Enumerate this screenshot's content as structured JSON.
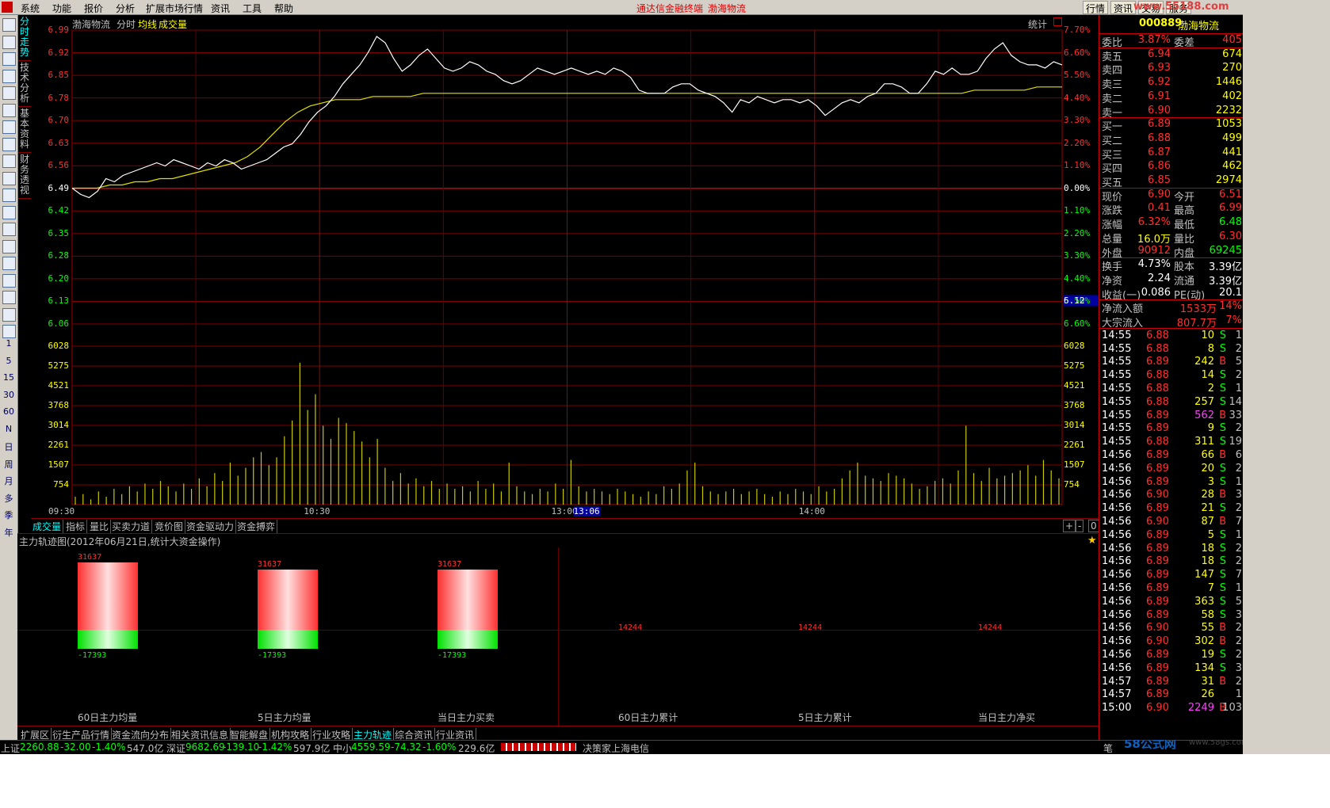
{
  "app": {
    "menu": [
      "系统",
      "功能",
      "报价",
      "分析",
      "扩展市场行情",
      "资讯",
      "工具",
      "帮助"
    ],
    "center_title": "通达信金融终端",
    "center_stock": "渤海物流",
    "right_buttons": [
      "行情",
      "资讯",
      "交易",
      "服务"
    ],
    "watermark": "www.55188.com",
    "footer_watermark": "58公式网",
    "footer_url": "www.58gs.com"
  },
  "left_toolbar": {
    "icon_names": [
      "home-icon",
      "grid-icon",
      "list-icon",
      "line-chart-icon",
      "candle-icon",
      "table-icon",
      "f10-icon",
      "news-icon",
      "report-icon",
      "f12-icon",
      "m-icon",
      "search-icon",
      "compare-icon",
      "multi-chart-icon",
      "analysis-icon",
      "percent-icon",
      "add-icon",
      "pen-icon",
      "f5-icon"
    ],
    "periods": [
      "1",
      "5",
      "15",
      "30",
      "60",
      "N",
      "日",
      "周",
      "月",
      "多",
      "季",
      "年"
    ]
  },
  "vertical_tabs": [
    "分时走势",
    "技术分析",
    "基本资料",
    "财务透视"
  ],
  "chart": {
    "stock_name": "渤海物流",
    "mode_label": "分时",
    "avg_label": "均线",
    "vol_label": "成交量",
    "stat_label": "统计",
    "price_ticks": [
      "6.99",
      "6.92",
      "6.85",
      "6.78",
      "6.70",
      "6.63",
      "6.56",
      "6.49",
      "6.42",
      "6.35",
      "6.28",
      "6.20",
      "6.13",
      "6.06"
    ],
    "pct_ticks": [
      "7.70%",
      "6.60%",
      "5.50%",
      "4.40%",
      "3.30%",
      "2.20%",
      "1.10%",
      "0.00%",
      "1.10%",
      "2.20%",
      "3.30%",
      "4.40%",
      "5.50%",
      "6.60%"
    ],
    "vol_ticks": [
      "6028",
      "5275",
      "4521",
      "3768",
      "3014",
      "2261",
      "1507",
      "754"
    ],
    "time_labels": [
      "09:30",
      "10:30",
      "13:00",
      "14:00"
    ],
    "cursor_time": "13:06",
    "cursor_price": "6.12",
    "tabs": [
      "成交量",
      "指标",
      "量比",
      "买卖力道",
      "竞价图",
      "资金驱动力",
      "资金搏弈"
    ],
    "zoom_buttons": [
      "+",
      "-",
      "0"
    ]
  },
  "chart_data": {
    "type": "line",
    "prev_close": 6.49,
    "ylim": [
      6.06,
      6.99
    ],
    "price_series": [
      6.49,
      6.47,
      6.46,
      6.48,
      6.52,
      6.51,
      6.53,
      6.54,
      6.55,
      6.56,
      6.57,
      6.56,
      6.58,
      6.57,
      6.56,
      6.55,
      6.57,
      6.56,
      6.58,
      6.57,
      6.55,
      6.56,
      6.57,
      6.58,
      6.6,
      6.62,
      6.63,
      6.66,
      6.7,
      6.73,
      6.75,
      6.78,
      6.82,
      6.85,
      6.88,
      6.92,
      6.97,
      6.95,
      6.9,
      6.86,
      6.88,
      6.91,
      6.93,
      6.9,
      6.87,
      6.86,
      6.87,
      6.89,
      6.88,
      6.86,
      6.85,
      6.83,
      6.82,
      6.83,
      6.85,
      6.87,
      6.86,
      6.85,
      6.86,
      6.87,
      6.86,
      6.85,
      6.86,
      6.85,
      6.87,
      6.86,
      6.84,
      6.8,
      6.79,
      6.79,
      6.79,
      6.81,
      6.82,
      6.82,
      6.8,
      6.79,
      6.78,
      6.76,
      6.73,
      6.77,
      6.76,
      6.78,
      6.77,
      6.76,
      6.77,
      6.77,
      6.76,
      6.77,
      6.75,
      6.72,
      6.74,
      6.76,
      6.77,
      6.76,
      6.78,
      6.79,
      6.82,
      6.82,
      6.81,
      6.79,
      6.79,
      6.82,
      6.86,
      6.85,
      6.87,
      6.85,
      6.85,
      6.86,
      6.9,
      6.93,
      6.95,
      6.91,
      6.89,
      6.88,
      6.88,
      6.87,
      6.89,
      6.88
    ],
    "avg_series": [
      6.49,
      6.49,
      6.49,
      6.5,
      6.5,
      6.51,
      6.51,
      6.52,
      6.52,
      6.53,
      6.54,
      6.55,
      6.56,
      6.57,
      6.59,
      6.62,
      6.66,
      6.7,
      6.73,
      6.75,
      6.76,
      6.77,
      6.77,
      6.77,
      6.78,
      6.78,
      6.78,
      6.78,
      6.79,
      6.79,
      6.79,
      6.79,
      6.79,
      6.79,
      6.79,
      6.79,
      6.79,
      6.79,
      6.79,
      6.79,
      6.79,
      6.79,
      6.79,
      6.79,
      6.79,
      6.79,
      6.79,
      6.79,
      6.79,
      6.79,
      6.79,
      6.79,
      6.79,
      6.79,
      6.79,
      6.79,
      6.79,
      6.79,
      6.79,
      6.79,
      6.79,
      6.79,
      6.79,
      6.79,
      6.79,
      6.79,
      6.79,
      6.79,
      6.79,
      6.79,
      6.79,
      6.79,
      6.8,
      6.8,
      6.8,
      6.8,
      6.8,
      6.81,
      6.81,
      6.81
    ],
    "volume_max": 6028,
    "volumes": [
      300,
      400,
      200,
      500,
      300,
      600,
      400,
      700,
      500,
      800,
      600,
      900,
      700,
      500,
      800,
      600,
      1000,
      700,
      1200,
      900,
      1600,
      1100,
      1400,
      1800,
      2000,
      1500,
      1800,
      2600,
      3200,
      5400,
      3600,
      4200,
      3000,
      2500,
      3300,
      3100,
      2800,
      2400,
      1800,
      2500,
      1400,
      900,
      1200,
      800,
      1000,
      700,
      900,
      600,
      800,
      600,
      700,
      500,
      900,
      600,
      800,
      500,
      1600,
      700,
      500,
      400,
      600,
      500,
      800,
      600,
      1700,
      700,
      500,
      600,
      500,
      400,
      600,
      500,
      400,
      300,
      500,
      400,
      700,
      600,
      800,
      1300,
      1600,
      700,
      500,
      400,
      500,
      600,
      400,
      500,
      600,
      400,
      300,
      500,
      400,
      600,
      500,
      400,
      700,
      500,
      600,
      1000,
      1300,
      1600,
      1100,
      1000,
      900,
      1200,
      1100,
      1000,
      800,
      600,
      700,
      900,
      1000,
      800,
      1300,
      3000,
      1200,
      900,
      1400,
      1000,
      1100,
      1200,
      1300,
      1500,
      1100,
      1700,
      1300,
      1000
    ]
  },
  "main_force": {
    "title": "主力轨迹图(2012年06月21日,统计大资金操作)",
    "groups": [
      {
        "label": "60日主力均量",
        "pos": "31637",
        "neg": "-17393"
      },
      {
        "label": "5日主力均量",
        "pos": "31637",
        "neg": "-17393"
      },
      {
        "label": "当日主力买卖",
        "pos": "31637",
        "neg": "-17393"
      },
      {
        "label": "60日主力累计",
        "pos": "14244",
        "neg": ""
      },
      {
        "label": "5日主力累计",
        "pos": "14244",
        "neg": ""
      },
      {
        "label": "当日主力净买",
        "pos": "14244",
        "neg": ""
      }
    ],
    "pos_values": [
      31637,
      31637,
      31637,
      14244,
      14244,
      14244
    ],
    "neg_values": [
      -17393,
      -17393,
      -17393,
      0,
      0,
      0
    ]
  },
  "bottom_tabs": [
    "扩展区",
    "衍生产品行情",
    "资金流向分布",
    "相关资讯信息",
    "智能解盘",
    "机构攻略",
    "行业攻略",
    "主力轨迹",
    "综合资讯",
    "行业资讯"
  ],
  "status": {
    "sh": {
      "name": "上证",
      "index": "2260.88",
      "chg": "-32.00",
      "pct": "-1.40%",
      "amt": "547.0亿"
    },
    "sz": {
      "name": "深证",
      "index": "9682.69",
      "chg": "-139.10",
      "pct": "-1.42%",
      "amt": "597.9亿"
    },
    "zx": {
      "name": "中小",
      "index": "4559.59",
      "chg": "-74.32",
      "pct": "-1.60%",
      "amt": "229.6亿"
    },
    "broker": "决策家上海电信",
    "right_label": "笔"
  },
  "quote": {
    "code": "000889",
    "name": "渤海物流",
    "weibi_label": "委比",
    "weibi": "3.87%",
    "weicha_label": "委差",
    "weicha": "405",
    "asks": [
      {
        "label": "卖五",
        "price": "6.94",
        "vol": "674"
      },
      {
        "label": "卖四",
        "price": "6.93",
        "vol": "270"
      },
      {
        "label": "卖三",
        "price": "6.92",
        "vol": "1446"
      },
      {
        "label": "卖二",
        "price": "6.91",
        "vol": "402"
      },
      {
        "label": "卖一",
        "price": "6.90",
        "vol": "2232"
      }
    ],
    "bids": [
      {
        "label": "买一",
        "price": "6.89",
        "vol": "1053"
      },
      {
        "label": "买二",
        "price": "6.88",
        "vol": "499"
      },
      {
        "label": "买三",
        "price": "6.87",
        "vol": "441"
      },
      {
        "label": "买四",
        "price": "6.86",
        "vol": "462"
      },
      {
        "label": "买五",
        "price": "6.85",
        "vol": "2974"
      }
    ],
    "stats": [
      {
        "l1": "现价",
        "v1": "6.90",
        "c1": "#ff3030",
        "l2": "今开",
        "v2": "6.51",
        "c2": "#ff3030"
      },
      {
        "l1": "涨跌",
        "v1": "0.41",
        "c1": "#ff3030",
        "l2": "最高",
        "v2": "6.99",
        "c2": "#ff3030"
      },
      {
        "l1": "涨幅",
        "v1": "6.32%",
        "c1": "#ff3030",
        "l2": "最低",
        "v2": "6.48",
        "c2": "#00ff00"
      },
      {
        "l1": "总量",
        "v1": "16.0万",
        "c1": "#ffff00",
        "l2": "量比",
        "v2": "6.30",
        "c2": "#ff3030"
      },
      {
        "l1": "外盘",
        "v1": "90912",
        "c1": "#ff3030",
        "l2": "内盘",
        "v2": "69245",
        "c2": "#00ff00"
      }
    ],
    "stats2": [
      {
        "l1": "换手",
        "v1": "4.73%",
        "l2": "股本",
        "v2": "3.39亿"
      },
      {
        "l1": "净资",
        "v1": "2.24",
        "l2": "流通",
        "v2": "3.39亿"
      },
      {
        "l1": "收益(一)",
        "v1": "0.086",
        "l2": "PE(动)",
        "v2": "20.1"
      }
    ],
    "flows": [
      {
        "label": "净流入额",
        "val": "1533万",
        "pct": "14%"
      },
      {
        "label": "大宗流入",
        "val": "807.7万",
        "pct": "7%"
      }
    ],
    "ticks": [
      {
        "t": "14:55",
        "p": "6.88",
        "v": "10",
        "d": "S",
        "n": "1"
      },
      {
        "t": "14:55",
        "p": "6.88",
        "v": "8",
        "d": "S",
        "n": "2"
      },
      {
        "t": "14:55",
        "p": "6.89",
        "v": "242",
        "d": "B",
        "n": "5"
      },
      {
        "t": "14:55",
        "p": "6.88",
        "v": "14",
        "d": "S",
        "n": "2"
      },
      {
        "t": "14:55",
        "p": "6.88",
        "v": "2",
        "d": "S",
        "n": "1"
      },
      {
        "t": "14:55",
        "p": "6.88",
        "v": "257",
        "d": "S",
        "n": "14"
      },
      {
        "t": "14:55",
        "p": "6.89",
        "v": "562",
        "d": "B",
        "n": "33"
      },
      {
        "t": "14:55",
        "p": "6.89",
        "v": "9",
        "d": "S",
        "n": "2"
      },
      {
        "t": "14:55",
        "p": "6.88",
        "v": "311",
        "d": "S",
        "n": "19"
      },
      {
        "t": "14:56",
        "p": "6.89",
        "v": "66",
        "d": "B",
        "n": "6"
      },
      {
        "t": "14:56",
        "p": "6.89",
        "v": "20",
        "d": "S",
        "n": "2"
      },
      {
        "t": "14:56",
        "p": "6.89",
        "v": "3",
        "d": "S",
        "n": "1"
      },
      {
        "t": "14:56",
        "p": "6.90",
        "v": "28",
        "d": "B",
        "n": "3"
      },
      {
        "t": "14:56",
        "p": "6.89",
        "v": "21",
        "d": "S",
        "n": "2"
      },
      {
        "t": "14:56",
        "p": "6.90",
        "v": "87",
        "d": "B",
        "n": "7"
      },
      {
        "t": "14:56",
        "p": "6.89",
        "v": "5",
        "d": "S",
        "n": "1"
      },
      {
        "t": "14:56",
        "p": "6.89",
        "v": "18",
        "d": "S",
        "n": "2"
      },
      {
        "t": "14:56",
        "p": "6.89",
        "v": "18",
        "d": "S",
        "n": "2"
      },
      {
        "t": "14:56",
        "p": "6.89",
        "v": "147",
        "d": "S",
        "n": "7"
      },
      {
        "t": "14:56",
        "p": "6.89",
        "v": "7",
        "d": "S",
        "n": "1"
      },
      {
        "t": "14:56",
        "p": "6.89",
        "v": "363",
        "d": "S",
        "n": "5"
      },
      {
        "t": "14:56",
        "p": "6.89",
        "v": "58",
        "d": "S",
        "n": "3"
      },
      {
        "t": "14:56",
        "p": "6.90",
        "v": "55",
        "d": "B",
        "n": "2"
      },
      {
        "t": "14:56",
        "p": "6.90",
        "v": "302",
        "d": "B",
        "n": "2"
      },
      {
        "t": "14:56",
        "p": "6.89",
        "v": "19",
        "d": "S",
        "n": "2"
      },
      {
        "t": "14:56",
        "p": "6.89",
        "v": "134",
        "d": "S",
        "n": "3"
      },
      {
        "t": "14:57",
        "p": "6.89",
        "v": "31",
        "d": "B",
        "n": "2"
      },
      {
        "t": "14:57",
        "p": "6.89",
        "v": "26",
        "d": "",
        "n": "1"
      },
      {
        "t": "15:00",
        "p": "6.90",
        "v": "2249",
        "d": "B",
        "n": "103"
      }
    ]
  }
}
